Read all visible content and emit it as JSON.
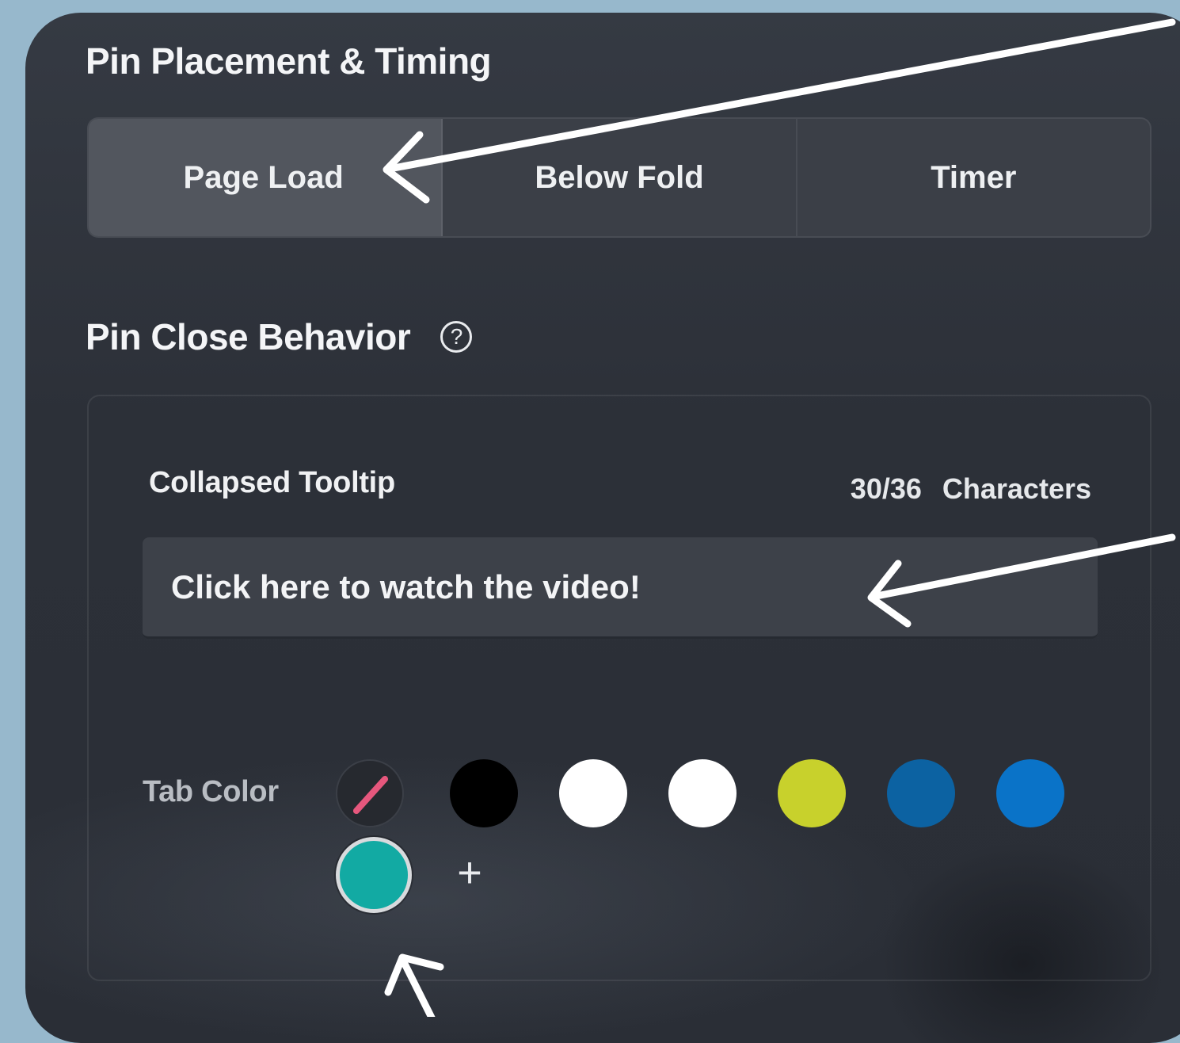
{
  "placement": {
    "title": "Pin Placement & Timing",
    "options": [
      "Page Load",
      "Below Fold",
      "Timer"
    ],
    "selected": "Page Load"
  },
  "close_behavior": {
    "title": "Pin Close Behavior",
    "help_glyph": "?",
    "help_icon": "question-circle-icon"
  },
  "tooltip": {
    "label": "Collapsed Tooltip",
    "char_count": "30/36",
    "char_unit": "Characters",
    "value": "Click here to watch the video!"
  },
  "tab_color": {
    "label": "Tab Color",
    "swatches": [
      {
        "name": "none",
        "color": "none"
      },
      {
        "name": "black",
        "color": "#000000"
      },
      {
        "name": "white",
        "color": "#ffffff"
      },
      {
        "name": "white-2",
        "color": "#ffffff"
      },
      {
        "name": "yellow-green",
        "color": "#c8d12c"
      },
      {
        "name": "dark-blue",
        "color": "#0c62a2"
      },
      {
        "name": "blue",
        "color": "#0a73c8"
      },
      {
        "name": "teal",
        "color": "#12aaa3"
      }
    ],
    "selected": "teal",
    "add_glyph": "+"
  },
  "colors": {
    "background": "#97b8cc",
    "panel": "#2c3038",
    "annotation_arrow": "#ffffff"
  }
}
